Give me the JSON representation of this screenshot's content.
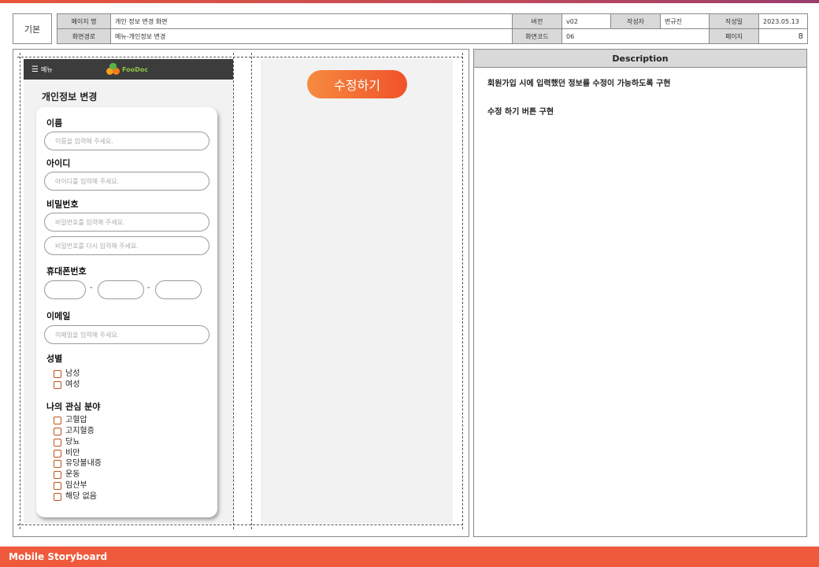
{
  "header": {
    "kind": "기본",
    "page_name_label": "페이지 명",
    "page_name": "개인 정보 변경 화면",
    "version_label": "버전",
    "version": "v02",
    "author_label": "작성자",
    "author": "변규진",
    "date_label": "작성일",
    "date": "2023.05.13",
    "path_label": "화면경로",
    "path": "메뉴-개인정보 변경",
    "code_label": "화면코드",
    "code": "06",
    "page_label": "페이지",
    "page": "8"
  },
  "phone": {
    "menu_label": "메뉴",
    "logo_text": "FooDoc",
    "title": "개인정보 변경",
    "name_label": "이름",
    "name_placeholder": "이름을 입력해 주세요.",
    "id_label": "아이디",
    "id_placeholder": "아이디를 입력해 주세요.",
    "password_label": "비밀번호",
    "password_placeholder": "비밀번호를 입력해 주세요.",
    "password_confirm_placeholder": "비밀번호를 다시 입력해 주세요.",
    "phone_label": "휴대폰번호",
    "phone_sep": "-",
    "email_label": "이메일",
    "email_placeholder": "이메일을 입력해 주세요.",
    "gender_label": "성별",
    "genders": [
      "남성",
      "여성"
    ],
    "interest_label": "나의 관심 분야",
    "interests": [
      "고혈압",
      "고지혈증",
      "당뇨",
      "비만",
      "유당불내증",
      "운동",
      "임산부",
      "해당 없음"
    ]
  },
  "middle": {
    "edit_button": "수정하기"
  },
  "description": {
    "title": "Description",
    "lines": [
      "회원가입 시에 입력했던 정보를 수정이 가능하도록 구현",
      "수정 하기 버튼 구현"
    ]
  },
  "footer": {
    "label": "Mobile Storyboard"
  },
  "colors": {
    "accent": "#ef5a3c",
    "button_start": "#f68b3f",
    "button_end": "#f0522a",
    "checkbox": "#c0501a",
    "phone_bar": "#3c3c3c"
  },
  "icons": [
    "menu-icon",
    "foodoc-logo-icon",
    "checkbox-icon"
  ]
}
